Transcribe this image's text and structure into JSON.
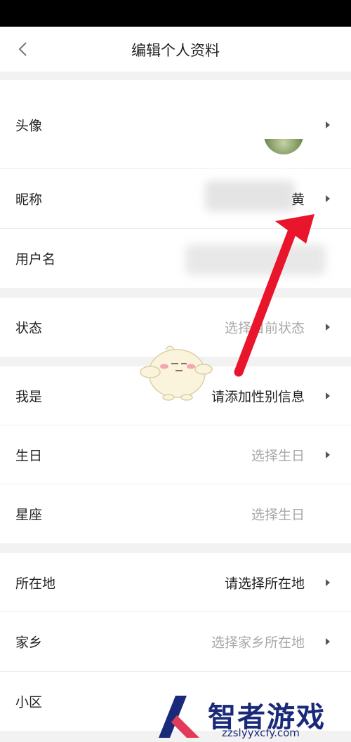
{
  "header": {
    "title": "编辑个人资料"
  },
  "profile": {
    "avatar_label": "头像",
    "nickname_label": "昵称",
    "nickname_value": "黄",
    "username_label": "用户名"
  },
  "status": {
    "label": "状态",
    "placeholder": "选择目前状态"
  },
  "personal": {
    "gender_label": "我是",
    "gender_value": "请添加性别信息",
    "birthday_label": "生日",
    "birthday_value": "选择生日",
    "zodiac_label": "星座",
    "zodiac_value": "选择生日"
  },
  "location": {
    "city_label": "所在地",
    "city_value": "请选择所在地",
    "hometown_label": "家乡",
    "hometown_value": "选择家乡所在地",
    "community_label": "小区"
  },
  "watermark": {
    "name": "智者游戏网",
    "url": "zzslyyxcfy.com"
  },
  "colors": {
    "annotation_arrow": "#e8152b",
    "accent_dark": "#1a2a7a"
  }
}
